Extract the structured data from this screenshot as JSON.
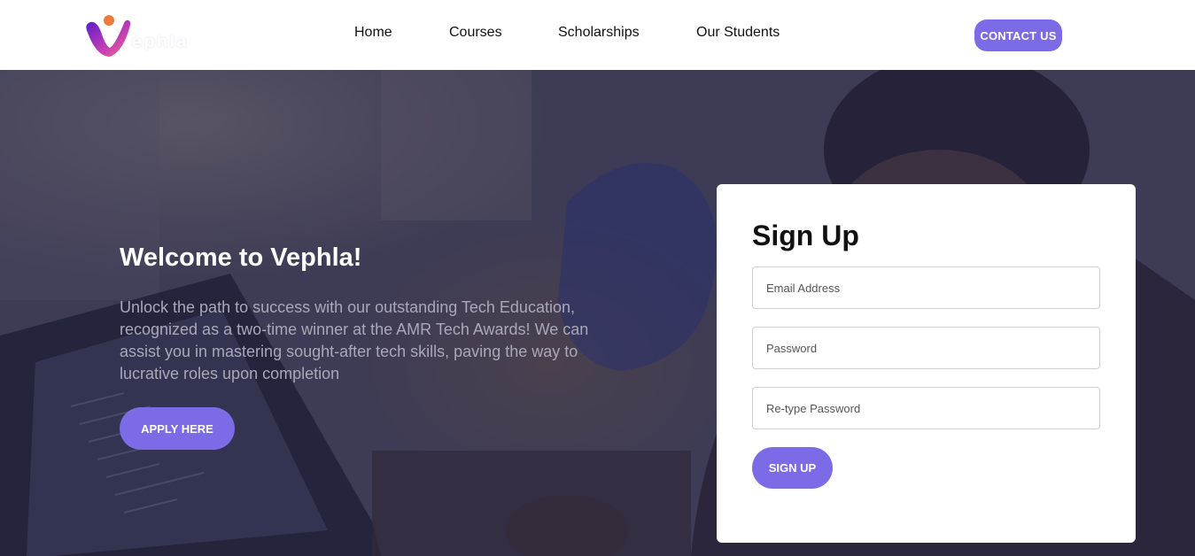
{
  "header": {
    "logo_text": "ephla",
    "nav": [
      {
        "label": "Home"
      },
      {
        "label": "Courses"
      },
      {
        "label": "Scholarships"
      },
      {
        "label": "Our Students"
      }
    ],
    "contact_label": "CONTACT US"
  },
  "hero": {
    "title": "Welcome to Vephla!",
    "description": "Unlock the path to success with our outstanding Tech Education, recognized as a two-time winner at the AMR Tech Awards! We can assist you in mastering sought-after tech skills, paving the way to lucrative roles upon completion",
    "apply_label": "APPLY HERE"
  },
  "signup": {
    "title": "Sign Up",
    "email_placeholder": "Email Address",
    "password_placeholder": "Password",
    "retype_placeholder": "Re-type Password",
    "button_label": "SIGN UP"
  },
  "colors": {
    "accent": "#7b6be6",
    "logo_gradient_start": "#6a1fd0",
    "logo_gradient_end": "#f05a8a"
  }
}
